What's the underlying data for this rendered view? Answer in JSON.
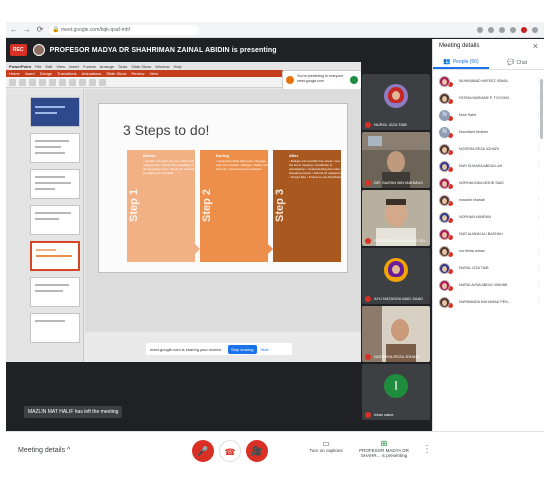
{
  "browser": {
    "url": "meet.google.com/bqk-qsaf-mhf"
  },
  "banner": {
    "rec": "REC",
    "presenter_text": "PROFESOR MADYA DR SHAHRIMAN ZAINAL ABIDIN is presenting"
  },
  "screen": {
    "ppt_menu": [
      "PowerPoint",
      "File",
      "Edit",
      "View",
      "Insert",
      "Format",
      "Arrange",
      "Tools",
      "Slide Show",
      "Window",
      "Help"
    ],
    "ppt_tabs": [
      "Home",
      "Insert",
      "Design",
      "Transitions",
      "Animations",
      "Slide Show",
      "Review",
      "View"
    ],
    "notice_text": "You're presenting to everyone meet.google.com",
    "slide": {
      "title": "3 Steps to do!",
      "steps": [
        {
          "label": "Step 1",
          "heading": "Before",
          "color": "#f2b184",
          "text": "• Identify a location for you • Inform all material lists • Check the availability of all necessary tools • Study the manual • Complete the checklist"
        },
        {
          "label": "Step 2",
          "heading": "During",
          "color": "#ed8f4a",
          "text": "• Inspecting while field work • Engage with communities • Budget • Safety and Security • Document any incidents"
        },
        {
          "label": "Step 3",
          "heading": "After",
          "color": "#a9581f",
          "text": "• Budget and monthly time sheet • Get the list of meeting • Certificate of participation • Understanding the rules • Speaking review • Submit for equipment • Output files • Protest to use Shorthand"
        }
      ]
    },
    "share_bar": {
      "text": "meet.google.com is sharing your screen.",
      "stop": "Stop sharing",
      "hide": "Hide"
    }
  },
  "toast": "MAZLIN MAT HALIF has left the meeting",
  "tiles": [
    {
      "name": "NURUL IZZA TAIB",
      "type": "avatar"
    },
    {
      "name": "DR. SAIFAN BIN MAHMUD",
      "type": "video"
    },
    {
      "name": "PROFESOR MADYA DR SH...",
      "type": "video"
    },
    {
      "name": "AYU NATASHA MAD SAAD",
      "type": "avatar"
    },
    {
      "name": "NOORISA REZA JOHARI",
      "type": "video"
    },
    {
      "name": "Intan zaine",
      "type": "letter",
      "letter": "I"
    }
  ],
  "panel": {
    "title": "Meeting details",
    "tabs": [
      {
        "label": "People (56)",
        "icon": "people-icon",
        "active": true
      },
      {
        "label": "Chat",
        "icon": "chat-icon",
        "active": false
      }
    ],
    "people": [
      "MUHAMMAD HAFEEZ ISMAIL",
      "FATIMA MARIANE P. TOYONG",
      "Nuur Sabri",
      "Noorhikmi Ibrahim",
      "NOORSA REZA JOHARI",
      "NUR SUHADA ABDULLAH",
      "NORHALINDA MOHD SAID",
      "norazrin shahab",
      "NORHAN KAMRAN",
      "NUR ALIANN ALI BASHAH",
      "nur fiesta adnan",
      "NURUL IZZA TAIB",
      "NURULAYNA ABDUL WAHAB",
      "NURWANDA MUHAMAD PEN..."
    ]
  },
  "controls": {
    "meeting_details": "Meeting details",
    "captions": "Turn on captions",
    "presenting": "PROFESOR MADYA DR SHAHR... is presenting"
  },
  "colors": {
    "mute_red": "#d93025",
    "meet_dark": "#202124",
    "accent_blue": "#1a73e8",
    "ppt_orange": "#c43e1c"
  }
}
